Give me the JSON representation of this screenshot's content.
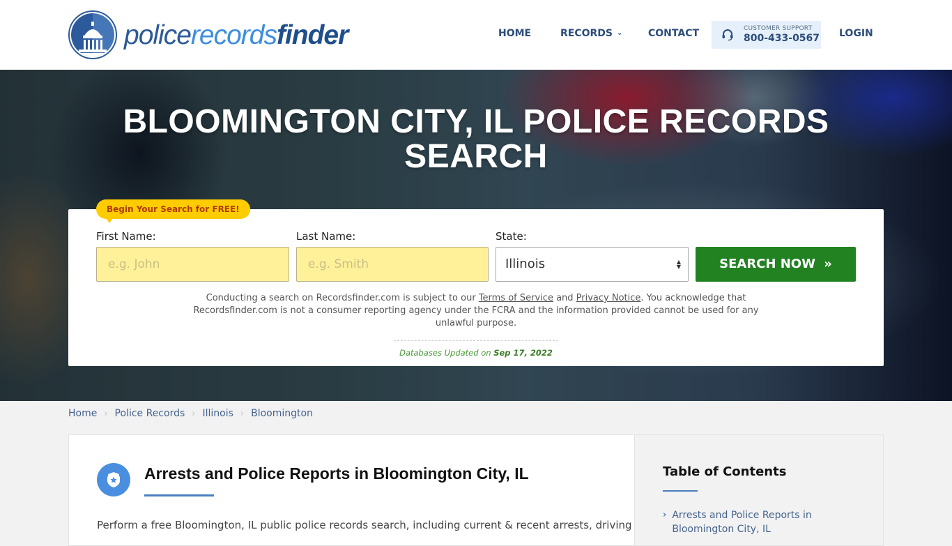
{
  "header": {
    "logo": {
      "part1": "police",
      "part2": "records",
      "part3": "finder"
    },
    "nav": [
      {
        "label": "HOME"
      },
      {
        "label": "RECORDS",
        "has_dropdown": true
      },
      {
        "label": "CONTACT"
      }
    ],
    "support": {
      "label": "CUSTOMER SUPPORT",
      "phone": "800-433-0567",
      "icon": "headset-icon"
    },
    "login_label": "LOGIN"
  },
  "hero": {
    "title": "BLOOMINGTON CITY, IL POLICE RECORDS SEARCH",
    "badge": "Begin Your Search for FREE!",
    "form": {
      "first_name_label": "First Name:",
      "first_name_placeholder": "e.g. John",
      "first_name_value": "",
      "last_name_label": "Last Name:",
      "last_name_placeholder": "e.g. Smith",
      "last_name_value": "",
      "state_label": "State:",
      "state_value": "Illinois",
      "submit_label": "SEARCH NOW",
      "submit_icon": "»"
    },
    "disclaimer": {
      "part1": "Conducting a search on Recordsfinder.com is subject to our ",
      "terms_link": "Terms of Service",
      "part2": " and ",
      "privacy_link": "Privacy Notice",
      "part3": ". You acknowledge that Recordsfinder.com is not a consumer reporting agency under the FCRA and the information provided cannot be used for any unlawful purpose."
    },
    "db_updated_label": "Databases Updated on ",
    "db_updated_date": "Sep 17, 2022"
  },
  "breadcrumb": [
    {
      "label": "Home"
    },
    {
      "label": "Police Records"
    },
    {
      "label": "Illinois"
    },
    {
      "label": "Bloomington"
    }
  ],
  "article": {
    "icon": "police-badge-icon",
    "title": "Arrests and Police Reports in Bloomington City, IL",
    "intro": "Perform a free Bloomington, IL public police records search, including current & recent arrests, driving"
  },
  "toc": {
    "title": "Table of Contents",
    "items": [
      {
        "label": "Arrests and Police Reports in Bloomington City, IL"
      }
    ]
  },
  "colors": {
    "nav_text": "#2d4d7a",
    "search_button": "#228222",
    "input_bg": "#fff199",
    "badge_bg": "#ffcc00",
    "accent_blue": "#4a8ee0"
  }
}
